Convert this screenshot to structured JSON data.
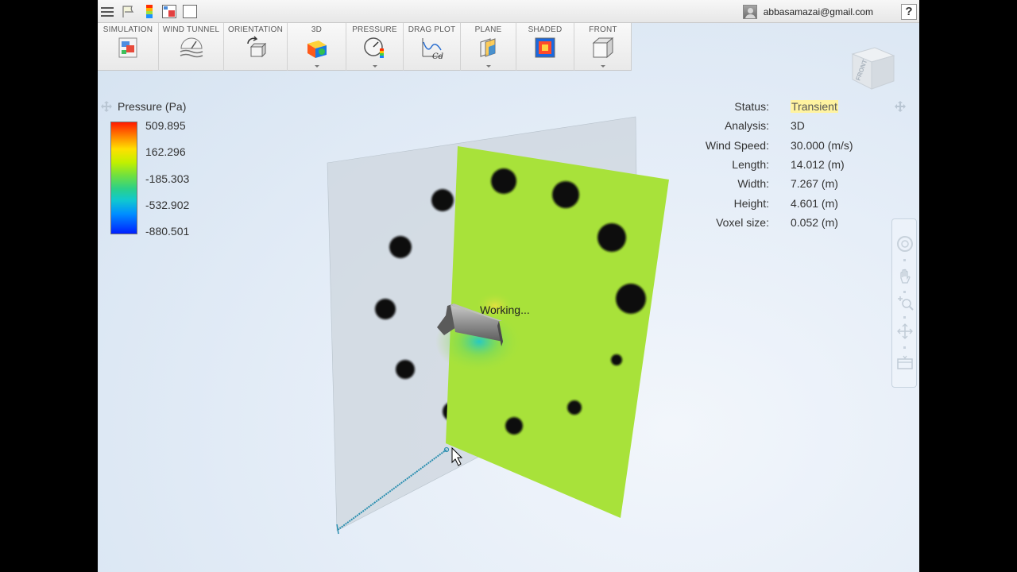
{
  "topbar": {
    "quick_access": [
      "menu-icon",
      "flag-icon",
      "colorbar-icon",
      "layout-icon",
      "window-icon"
    ],
    "user_email": "abbasamazai@gmail.com",
    "help_label": "?"
  },
  "ribbon": {
    "buttons": [
      {
        "label": "SIMULATION",
        "icon": "simulation-icon"
      },
      {
        "label": "WIND TUNNEL",
        "icon": "wind-tunnel-icon"
      },
      {
        "label": "ORIENTATION",
        "icon": "orientation-icon"
      },
      {
        "label": "3D",
        "icon": "3d-icon"
      },
      {
        "label": "PRESSURE",
        "icon": "pressure-gauge-icon"
      },
      {
        "label": "DRAG PLOT",
        "icon": "drag-plot-icon"
      },
      {
        "label": "PLANE",
        "icon": "plane-icon"
      },
      {
        "label": "SHADED",
        "icon": "shaded-icon"
      },
      {
        "label": "FRONT",
        "icon": "front-view-icon"
      }
    ]
  },
  "legend": {
    "title": "Pressure (Pa)",
    "values": [
      "509.895",
      "162.296",
      "-185.303",
      "-532.902",
      "-880.501"
    ],
    "colors": [
      "#ff1a00",
      "#ff8000",
      "#ffe000",
      "#c2f000",
      "#2ad08a",
      "#10c8d0",
      "#0090ff",
      "#0020ff"
    ]
  },
  "stats": [
    {
      "label": "Status:",
      "value": "Transient"
    },
    {
      "label": "Analysis:",
      "value": "3D"
    },
    {
      "label": "Wind Speed:",
      "value": "30.000 (m/s)"
    },
    {
      "label": "Length:",
      "value": "14.012 (m)"
    },
    {
      "label": "Width:",
      "value": "7.267 (m)"
    },
    {
      "label": "Height:",
      "value": "4.601 (m)"
    },
    {
      "label": "Voxel size:",
      "value": "0.052 (m)"
    }
  ],
  "viewport": {
    "working_text": "Working...",
    "view_cube_face": "FRONT",
    "plane_color": "#a8e23a"
  },
  "navbar": {
    "tools": [
      "full-navigation-wheel-icon",
      "pan-hand-icon",
      "zoom-icon",
      "orbit-icon",
      "look-at-icon"
    ]
  }
}
